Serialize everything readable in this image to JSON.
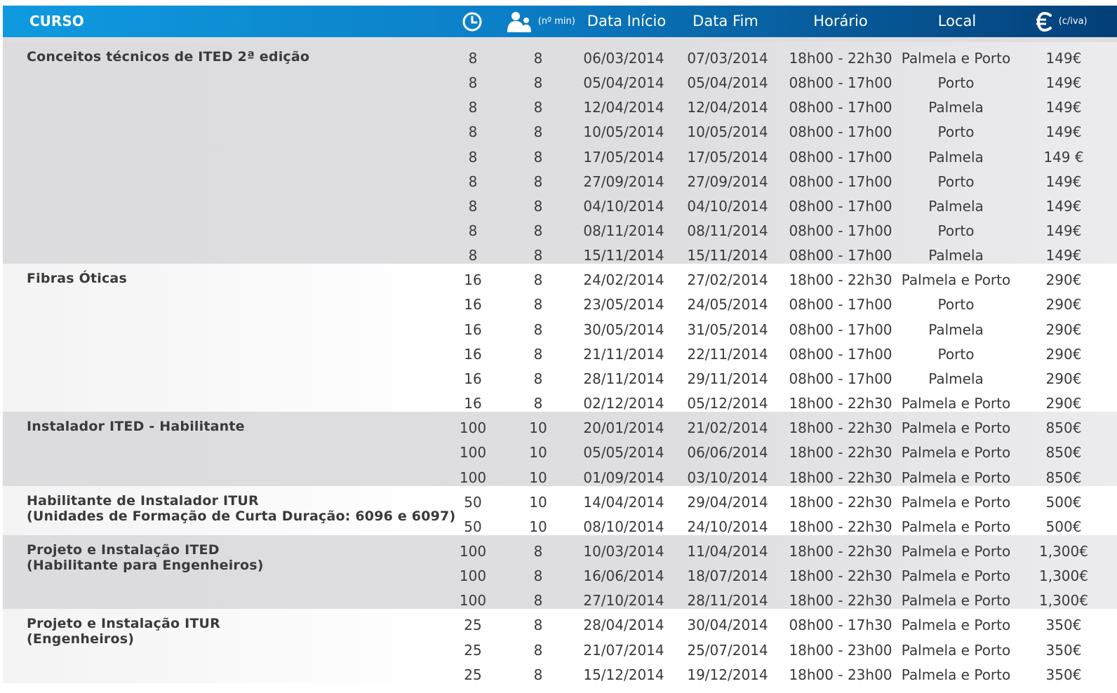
{
  "header": {
    "course_label": "CURSO",
    "duration_icon": "clock-icon",
    "participants_icon": "people-icon",
    "participants_note": "(nº min)",
    "start_label": "Data Início",
    "end_label": "Data Fim",
    "schedule_label": "Horário",
    "location_label": "Local",
    "price_icon": "euro-icon",
    "price_note": "(c/iva)"
  },
  "groups": [
    {
      "name": "Conceitos técnicos de ITED 2ª edição",
      "sessions": [
        {
          "hours": "8",
          "min": "8",
          "start": "06/03/2014",
          "end": "07/03/2014",
          "schedule": "18h00 - 22h30",
          "location": "Palmela e Porto",
          "price": "149€"
        },
        {
          "hours": "8",
          "min": "8",
          "start": "05/04/2014",
          "end": "05/04/2014",
          "schedule": "08h00 - 17h00",
          "location": "Porto",
          "price": "149€"
        },
        {
          "hours": "8",
          "min": "8",
          "start": "12/04/2014",
          "end": "12/04/2014",
          "schedule": "08h00 - 17h00",
          "location": "Palmela",
          "price": "149€"
        },
        {
          "hours": "8",
          "min": "8",
          "start": "10/05/2014",
          "end": "10/05/2014",
          "schedule": "08h00 - 17h00",
          "location": "Porto",
          "price": "149€"
        },
        {
          "hours": "8",
          "min": "8",
          "start": "17/05/2014",
          "end": "17/05/2014",
          "schedule": "08h00 - 17h00",
          "location": "Palmela",
          "price": "149 €"
        },
        {
          "hours": "8",
          "min": "8",
          "start": "27/09/2014",
          "end": "27/09/2014",
          "schedule": "08h00 - 17h00",
          "location": "Porto",
          "price": "149€"
        },
        {
          "hours": "8",
          "min": "8",
          "start": "04/10/2014",
          "end": "04/10/2014",
          "schedule": "08h00 - 17h00",
          "location": "Palmela",
          "price": "149€"
        },
        {
          "hours": "8",
          "min": "8",
          "start": "08/11/2014",
          "end": "08/11/2014",
          "schedule": "08h00 - 17h00",
          "location": "Porto",
          "price": "149€"
        },
        {
          "hours": "8",
          "min": "8",
          "start": "15/11/2014",
          "end": "15/11/2014",
          "schedule": "08h00 - 17h00",
          "location": "Palmela",
          "price": "149€"
        }
      ]
    },
    {
      "name": "Fibras Óticas",
      "sessions": [
        {
          "hours": "16",
          "min": "8",
          "start": "24/02/2014",
          "end": "27/02/2014",
          "schedule": "18h00 - 22h30",
          "location": "Palmela e Porto",
          "price": "290€"
        },
        {
          "hours": "16",
          "min": "8",
          "start": "23/05/2014",
          "end": "24/05/2014",
          "schedule": "08h00 - 17h00",
          "location": "Porto",
          "price": "290€"
        },
        {
          "hours": "16",
          "min": "8",
          "start": "30/05/2014",
          "end": "31/05/2014",
          "schedule": "08h00 - 17h00",
          "location": "Palmela",
          "price": "290€"
        },
        {
          "hours": "16",
          "min": "8",
          "start": "21/11/2014",
          "end": "22/11/2014",
          "schedule": "08h00 - 17h00",
          "location": "Porto",
          "price": "290€"
        },
        {
          "hours": "16",
          "min": "8",
          "start": "28/11/2014",
          "end": "29/11/2014",
          "schedule": "08h00 - 17h00",
          "location": "Palmela",
          "price": "290€"
        },
        {
          "hours": "16",
          "min": "8",
          "start": "02/12/2014",
          "end": "05/12/2014",
          "schedule": "18h00 - 22h30",
          "location": "Palmela e Porto",
          "price": "290€"
        }
      ]
    },
    {
      "name": "Instalador ITED - Habilitante",
      "sessions": [
        {
          "hours": "100",
          "min": "10",
          "start": "20/01/2014",
          "end": "21/02/2014",
          "schedule": "18h00 - 22h30",
          "location": "Palmela e Porto",
          "price": "850€"
        },
        {
          "hours": "100",
          "min": "10",
          "start": "05/05/2014",
          "end": "06/06/2014",
          "schedule": "18h00 - 22h30",
          "location": "Palmela e Porto",
          "price": "850€"
        },
        {
          "hours": "100",
          "min": "10",
          "start": "01/09/2014",
          "end": "03/10/2014",
          "schedule": "18h00 - 22h30",
          "location": "Palmela e Porto",
          "price": "850€"
        }
      ]
    },
    {
      "name": "Habilitante de Instalador ITUR\n(Unidades de Formação de Curta Duração: 6096 e 6097)",
      "sessions": [
        {
          "hours": "50",
          "min": "10",
          "start": "14/04/2014",
          "end": "29/04/2014",
          "schedule": "18h00 - 22h30",
          "location": "Palmela e Porto",
          "price": "500€"
        },
        {
          "hours": "50",
          "min": "10",
          "start": "08/10/2014",
          "end": "24/10/2014",
          "schedule": "18h00 - 22h30",
          "location": "Palmela e Porto",
          "price": "500€"
        }
      ]
    },
    {
      "name": "Projeto e Instalação ITED\n(Habilitante para Engenheiros)",
      "sessions": [
        {
          "hours": "100",
          "min": "8",
          "start": "10/03/2014",
          "end": "11/04/2014",
          "schedule": "18h00 - 22h30",
          "location": "Palmela e Porto",
          "price": "1,300€"
        },
        {
          "hours": "100",
          "min": "8",
          "start": "16/06/2014",
          "end": "18/07/2014",
          "schedule": "18h00 - 22h30",
          "location": "Palmela e Porto",
          "price": "1,300€"
        },
        {
          "hours": "100",
          "min": "8",
          "start": "27/10/2014",
          "end": "28/11/2014",
          "schedule": "18h00 - 22h30",
          "location": "Palmela e Porto",
          "price": "1,300€"
        }
      ]
    },
    {
      "name": "Projeto e Instalação ITUR\n(Engenheiros)",
      "sessions": [
        {
          "hours": "25",
          "min": "8",
          "start": "28/04/2014",
          "end": "30/04/2014",
          "schedule": "08h00 - 17h30",
          "location": "Palmela e Porto",
          "price": "350€"
        },
        {
          "hours": "25",
          "min": "8",
          "start": "21/07/2014",
          "end": "25/07/2014",
          "schedule": "18h00 - 23h00",
          "location": "Palmela e Porto",
          "price": "350€"
        },
        {
          "hours": "25",
          "min": "8",
          "start": "15/12/2014",
          "end": "19/12/2014",
          "schedule": "18h00 - 23h00",
          "location": "Palmela e Porto",
          "price": "350€"
        }
      ]
    }
  ]
}
